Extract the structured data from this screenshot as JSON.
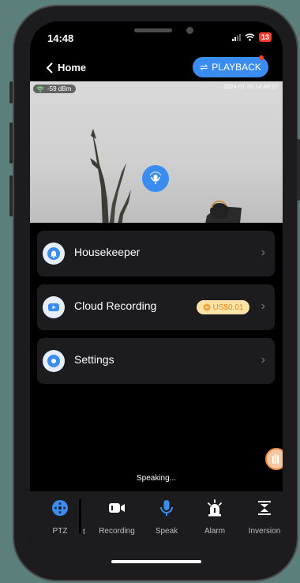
{
  "status_bar": {
    "time": "14:48",
    "battery": "13"
  },
  "nav": {
    "back_label": "Home",
    "playback_label": "PLAYBACK",
    "swap_glyph": "⇌"
  },
  "video": {
    "signal_text": "-59 dBm",
    "timestamp": "2024-01-30 14:48:37"
  },
  "menu": [
    {
      "label": "Housekeeper",
      "icon": "bell-icon"
    },
    {
      "label": "Cloud Recording",
      "icon": "video-icon",
      "price": "US$0.01"
    },
    {
      "label": "Settings",
      "icon": "settings-icon"
    }
  ],
  "status_text": "Speaking...",
  "toolbar": {
    "items": [
      {
        "label": "PTZ",
        "icon": "ptz-icon",
        "active": true
      },
      {
        "label": "Recording",
        "icon": "camera-record-icon",
        "active": false
      },
      {
        "label": "Speak",
        "icon": "microphone-icon",
        "active": true
      },
      {
        "label": "Alarm",
        "icon": "alarm-siren-icon",
        "active": false
      },
      {
        "label": "Inversion",
        "icon": "flip-icon",
        "active": false
      }
    ],
    "stray_char": "t"
  },
  "colors": {
    "accent": "#3b8cf0",
    "card_bg": "#1c1c1e",
    "price_bg": "#fbe3a8",
    "price_text": "#e58b1a",
    "alert": "#ff3b30"
  }
}
